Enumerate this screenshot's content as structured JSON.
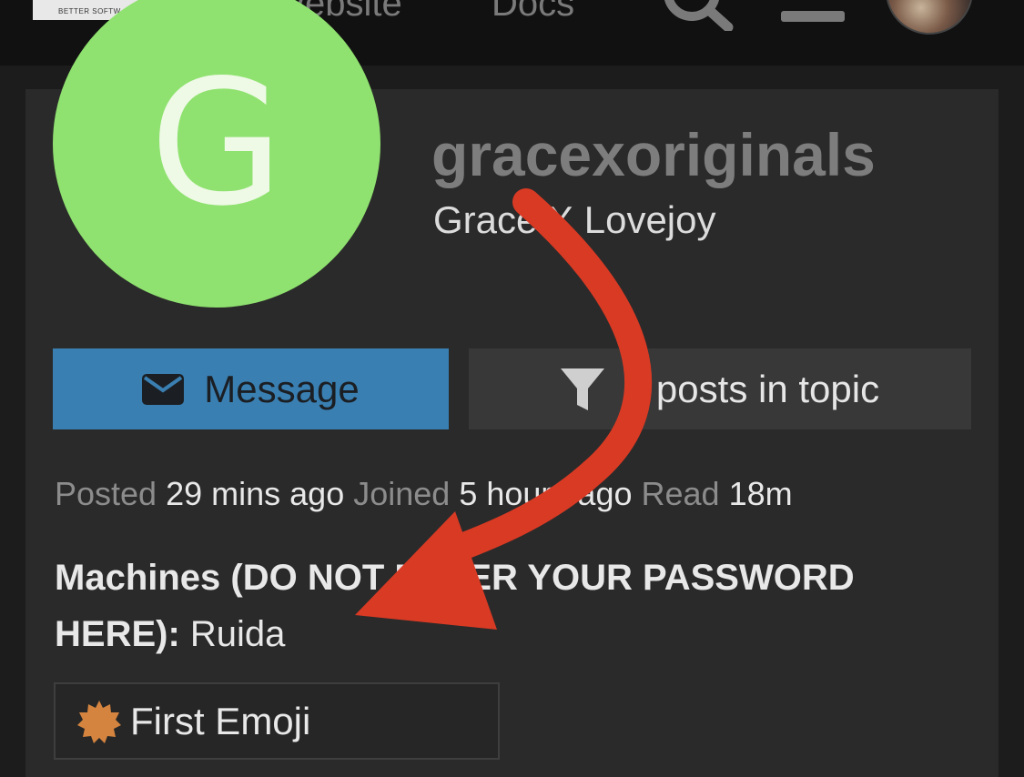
{
  "header": {
    "logo_text": "BETTER SOFTW",
    "nav": [
      "Website",
      "Docs"
    ],
    "icons": [
      "search-icon",
      "hamburger-menu-icon",
      "user-avatar"
    ]
  },
  "profile": {
    "avatar_letter": "G",
    "avatar_color": "#8fe26f",
    "username": "gracexoriginals",
    "full_name": "Grace X Lovejoy"
  },
  "buttons": {
    "message_label": "Message",
    "filter_label": "4 posts in topic"
  },
  "meta": {
    "posted_label": "Posted",
    "posted_value": "29 mins ago",
    "joined_label": "Joined",
    "joined_value": "5 hours ago",
    "read_label": "Read",
    "read_value": "18m"
  },
  "custom_field": {
    "label": "Machines (DO NOT ENTER YOUR PASSWORD HERE):",
    "value": "Ruida"
  },
  "badge": {
    "label": "First Emoji",
    "icon": "badge-star-icon",
    "icon_color": "#d4843f"
  },
  "annotation": {
    "arrow_color": "#d93a24"
  },
  "colors": {
    "message_button": "#3a7fb1",
    "card_background": "#2a2a2a"
  }
}
